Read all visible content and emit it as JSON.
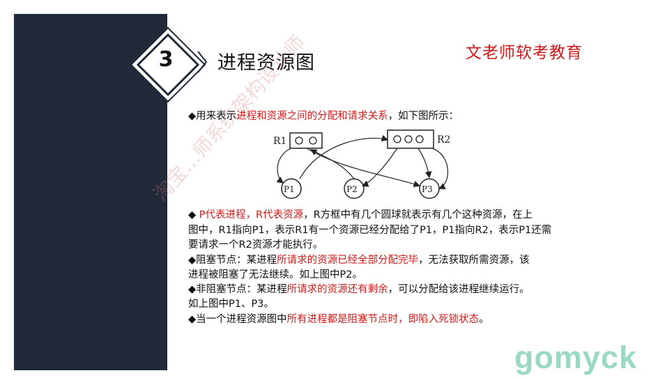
{
  "section": {
    "number": "3",
    "title": "进程资源图"
  },
  "brand": "文老师软考教育",
  "watermark": {
    "diagonal_text": "淘宝…师系统架构设计师"
  },
  "intro": {
    "prefix": "◆用来表示",
    "highlight": "进程和资源之间的分配和请求关系",
    "suffix": "，如下图所示："
  },
  "diagram": {
    "resources": [
      "R1",
      "R2"
    ],
    "processes": [
      "P1",
      "P2",
      "P3"
    ]
  },
  "para1": {
    "bullet": "◆ ",
    "highlight": "P代表进程，R代表资源",
    "text1": "，R方框中有几个圆球就表示有几个这种资源，在上",
    "line2": "图中，R1指向P1，表示R1有一个资源已经分配给了P1，P1指向R2，表示P1还需",
    "line3": "要请求一个R2资源才能执行。"
  },
  "para2": {
    "prefix": "◆阻塞节点：某进程",
    "highlight": "所请求的资源已经全部分配完毕",
    "suffix": "，无法获取所需资源，该",
    "line2": "进程被阻塞了无法继续。如上图中P2。"
  },
  "para3": {
    "prefix": "◆非阻塞节点：某进程",
    "highlight": "所请求的资源还有剩余",
    "suffix": "，可以分配给该进程继续运行。",
    "line2": "如上图中P1、P3。"
  },
  "para4": {
    "prefix": "◆当一个进程资源图中",
    "highlight": "所有进程都是阻塞节点时，即陷入死锁状态",
    "suffix": "。"
  },
  "footer": "gomyck"
}
